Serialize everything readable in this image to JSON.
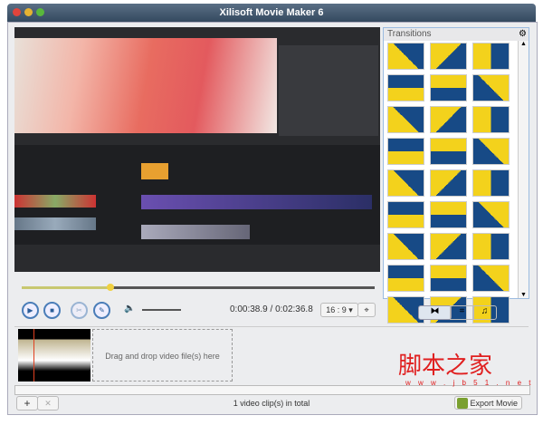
{
  "window": {
    "title": "Xilisoft Movie Maker 6"
  },
  "transitions": {
    "title": "Transitions",
    "tile_count": 27,
    "colors": {
      "yellow": "#f3d21c",
      "blue": "#174a86"
    }
  },
  "player": {
    "current_time": "0:00:38.9",
    "separator": " / ",
    "total_time": "0:02:36.8",
    "aspect": "16 : 9 ▾",
    "progress_percent": 25
  },
  "panel_tabs": [
    "transitions",
    "crop",
    "music"
  ],
  "timeline": {
    "drop_hint": "Drag and drop video file(s) here"
  },
  "bottom": {
    "add": "+",
    "remove": "✕",
    "status": "1 video clip(s) in total",
    "export": "Export Movie"
  },
  "watermark": {
    "text": "脚本之家",
    "url": "w w w . j b 5 1 . n e t"
  }
}
